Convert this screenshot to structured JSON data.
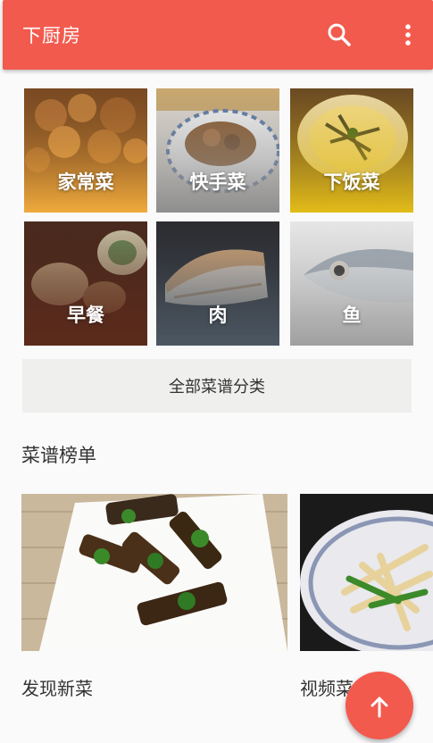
{
  "appbar": {
    "title": "下厨房",
    "search_icon": "search-icon",
    "more_icon": "more-vert-icon",
    "color": "#f25a4e"
  },
  "categories": [
    {
      "label": "家常菜",
      "tint": "#e8a33a"
    },
    {
      "label": "快手菜",
      "tint": "#8c8c8c"
    },
    {
      "label": "下饭菜",
      "tint": "#d9b51c"
    },
    {
      "label": "早餐",
      "tint": "#5a2a1c"
    },
    {
      "label": "肉",
      "tint": "#4a5560"
    },
    {
      "label": "鱼",
      "tint": "#9a9a9a"
    }
  ],
  "all_categories_label": "全部菜谱分类",
  "ranking": {
    "title": "菜谱榜单",
    "cards": [
      {
        "label": "发现新菜"
      },
      {
        "label": "视频菜"
      }
    ]
  },
  "fab_icon": "arrow-up-icon"
}
